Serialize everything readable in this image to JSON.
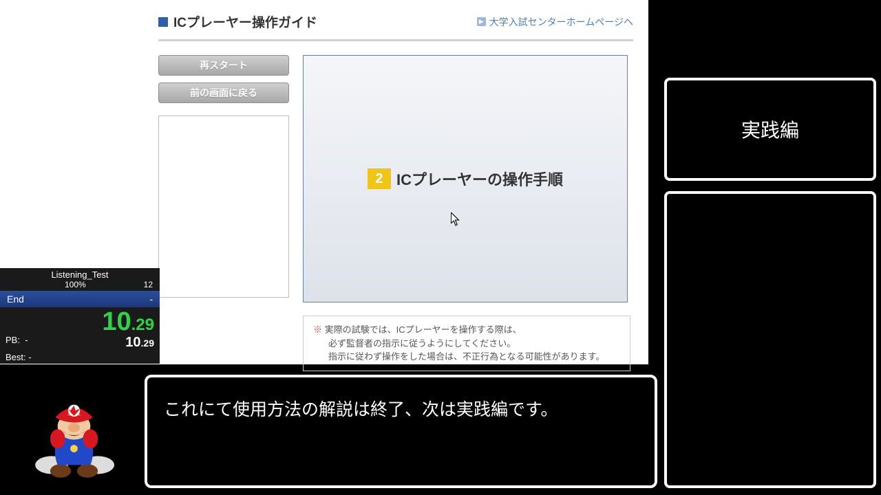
{
  "page": {
    "title": "ICプレーヤー操作ガイド",
    "link_text": "大学入試センターホームページへ",
    "restart_label": "再スタート",
    "back_label": "前の画面に戻る",
    "step_number": "2",
    "step_title": "ICプレーヤーの操作手順",
    "warning_mark": "※",
    "warning_line1": "実際の試験では、ICプレーヤーを操作する際は、",
    "warning_line2": "必ず監督者の指示に従うようにしてください。",
    "warning_line3": "指示に従わず操作をした場合は、不正行為となる可能性があります。"
  },
  "splits": {
    "title": "Listening_Test",
    "percent": "100%",
    "count": "12",
    "segment_name": "End",
    "segment_delta": "-",
    "big_whole": "10",
    "big_dec": ".29",
    "pb_label": "PB:",
    "pb_value": "-",
    "pb_time_whole": "10",
    "pb_time_dec": ".29",
    "best_label": "Best:",
    "best_value": "-"
  },
  "dialog": {
    "text": "これにて使用方法の解説は終了、次は実践編です。"
  },
  "side": {
    "top_label": "実践編"
  }
}
